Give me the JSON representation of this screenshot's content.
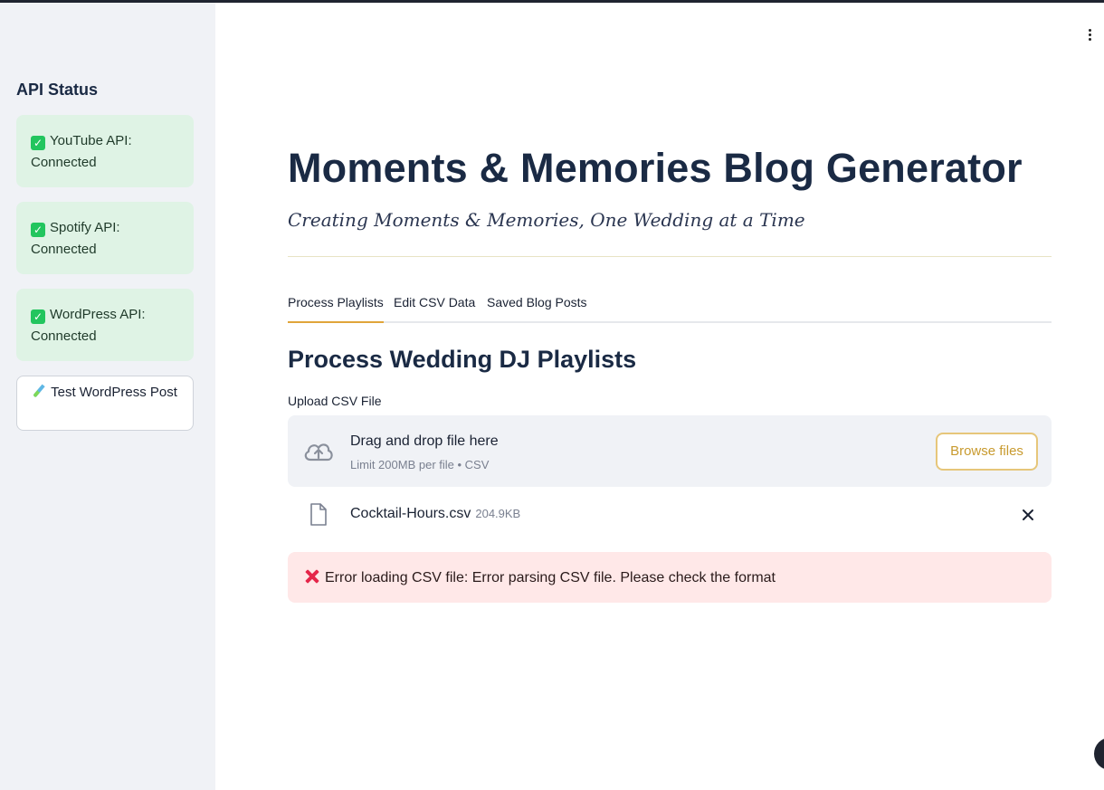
{
  "sidebar": {
    "title": "API Status",
    "statuses": [
      {
        "label": "YouTube API:",
        "status": "Connected"
      },
      {
        "label": "Spotify API:",
        "status": "Connected"
      },
      {
        "label": "WordPress API:",
        "status": "Connected"
      }
    ],
    "test_button": {
      "label": "Test WordPress Post",
      "icon": "test-tube-icon"
    }
  },
  "header": {
    "title": "Moments & Memories Blog Generator",
    "subtitle": "Creating Moments & Memories, One Wedding at a Time"
  },
  "tabs": [
    {
      "label": "Process Playlists",
      "active": true
    },
    {
      "label": "Edit CSV Data",
      "active": false
    },
    {
      "label": "Saved Blog Posts",
      "active": false
    }
  ],
  "main": {
    "section_title": "Process Wedding DJ Playlists",
    "upload": {
      "label": "Upload CSV File",
      "drop_title": "Drag and drop file here",
      "limit_text": "Limit 200MB per file • CSV",
      "browse_label": "Browse files"
    },
    "file": {
      "name": "Cocktail-Hours.csv",
      "size": "204.9KB"
    },
    "error": "Error loading CSV file: Error parsing CSV file. Please check the format"
  },
  "colors": {
    "accent": "#e0a53a",
    "success_bg": "#dff3e5",
    "error_bg": "#ffe8e8",
    "error_icon": "#e5264a"
  }
}
